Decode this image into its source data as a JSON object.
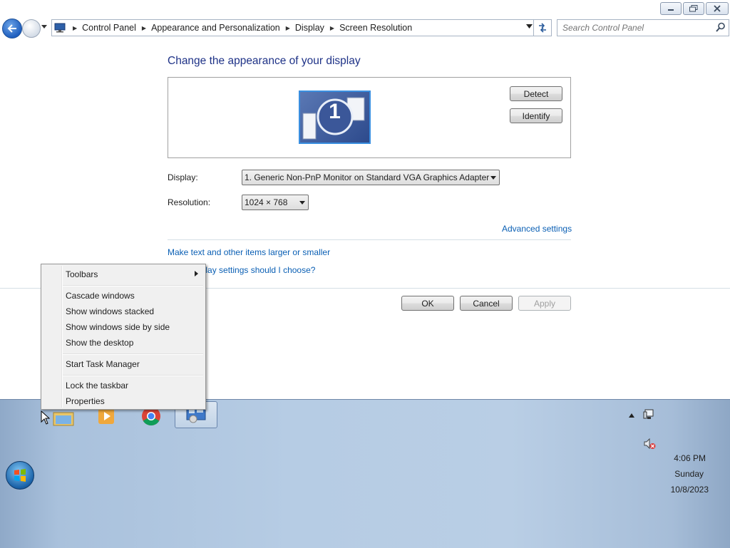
{
  "window": {
    "caption_buttons": [
      "minimize",
      "restore",
      "close"
    ]
  },
  "addressbar": {
    "crumbs": [
      "Control Panel",
      "Appearance and Personalization",
      "Display",
      "Screen Resolution"
    ],
    "search_placeholder": "Search Control Panel"
  },
  "main": {
    "title": "Change the appearance of your display",
    "monitor_number": "1",
    "detect_label": "Detect",
    "identify_label": "Identify",
    "display_label": "Display:",
    "display_value": "1. Generic Non-PnP Monitor on Standard VGA Graphics Adapter",
    "resolution_label": "Resolution:",
    "resolution_value": "1024 × 768",
    "advanced_link": "Advanced settings",
    "text_size_link": "Make text and other items larger or smaller",
    "which_settings_link": "What display settings should I choose?",
    "ok_label": "OK",
    "cancel_label": "Cancel",
    "apply_label": "Apply"
  },
  "context_menu": {
    "items": [
      "Toolbars",
      "Cascade windows",
      "Show windows stacked",
      "Show windows side by side",
      "Show the desktop",
      "Start Task Manager",
      "Lock the taskbar",
      "Properties"
    ]
  },
  "taskbar": {
    "pinned": [
      "windows-explorer-icon",
      "media-player-icon",
      "chrome-icon",
      "control-panel-icon"
    ],
    "clock": {
      "time": "4:06 PM",
      "day": "Sunday",
      "date": "10/8/2023"
    }
  },
  "colors": {
    "title": "#1e3287",
    "link": "#0a5fb4",
    "taskbar": "#b6cce4"
  }
}
